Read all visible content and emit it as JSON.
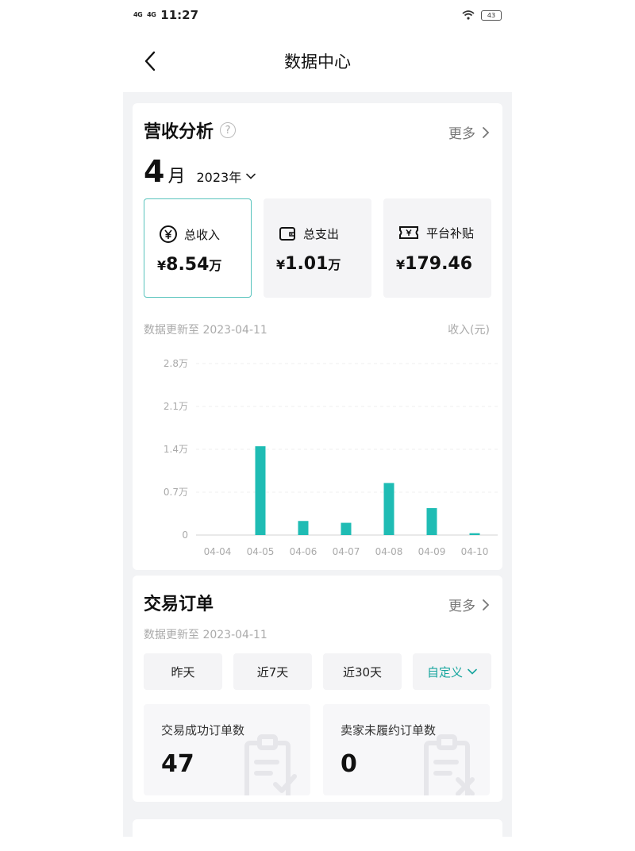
{
  "status_bar": {
    "signal_1": "4G",
    "signal_2": "4G",
    "time": "11:27",
    "battery": "43"
  },
  "nav": {
    "title": "数据中心"
  },
  "revenue": {
    "title": "营收分析",
    "more_label": "更多",
    "month_number": "4",
    "month_unit": "月",
    "year": "2023年",
    "stats": [
      {
        "label": "总收入",
        "currency": "¥",
        "amount": "8.54",
        "unit": "万",
        "icon": "yuan-circle-icon"
      },
      {
        "label": "总支出",
        "currency": "¥",
        "amount": "1.01",
        "unit": "万",
        "icon": "wallet-icon"
      },
      {
        "label": "平台补贴",
        "currency": "¥",
        "amount": "179.46",
        "unit": "",
        "icon": "ticket-icon"
      }
    ],
    "update_note": "数据更新至 2023-04-11",
    "unit_note": "收入(元)"
  },
  "chart_data": {
    "type": "bar",
    "categories": [
      "04-04",
      "04-05",
      "04-06",
      "04-07",
      "04-08",
      "04-09",
      "04-10"
    ],
    "values": [
      0,
      14500,
      2300,
      2000,
      8500,
      4400,
      300
    ],
    "y_tick_labels": [
      "0",
      "0.7万",
      "1.4万",
      "2.1万",
      "2.8万"
    ],
    "y_ticks": [
      0,
      7000,
      14000,
      21000,
      28000
    ],
    "ylim": [
      0,
      28000
    ],
    "bar_color": "#1fbcb4",
    "grid": true
  },
  "orders": {
    "title": "交易订单",
    "more_label": "更多",
    "update_note": "数据更新至 2023-04-11",
    "ranges": [
      "昨天",
      "近7天",
      "近30天",
      "自定义"
    ],
    "metrics": [
      {
        "label": "交易成功订单数",
        "value": "47"
      },
      {
        "label": "卖家未履约订单数",
        "value": "0"
      }
    ]
  },
  "colors": {
    "accent": "#1fbcb4",
    "accent_text": "#17a59e",
    "page_bg": "#f2f3f5"
  }
}
